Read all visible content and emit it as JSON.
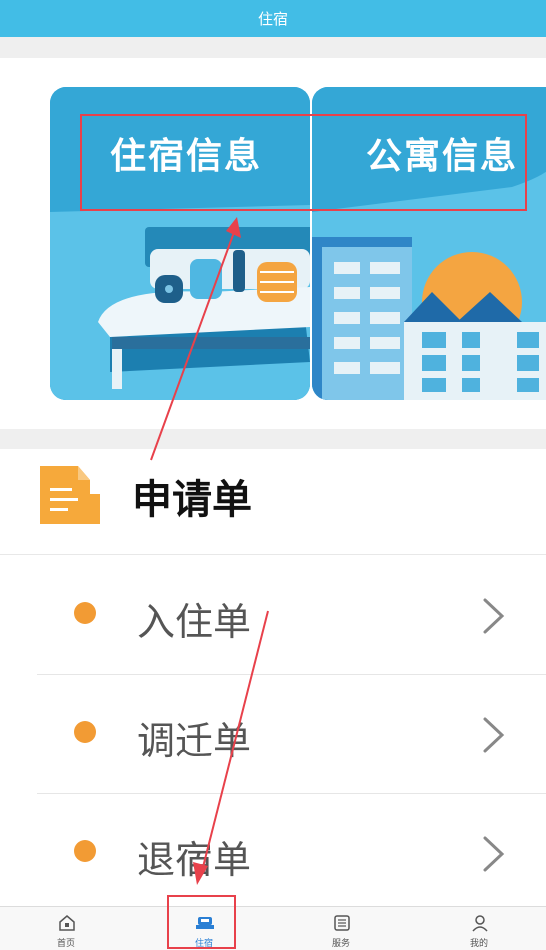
{
  "header": {
    "title": "住宿"
  },
  "banner": {
    "cards": [
      {
        "title": "住宿信息"
      },
      {
        "title": "公寓信息"
      }
    ]
  },
  "application": {
    "title": "申请单",
    "items": [
      {
        "label": "入住单"
      },
      {
        "label": "调迁单"
      },
      {
        "label": "退宿单"
      }
    ]
  },
  "tabbar": {
    "items": [
      {
        "label": "首页",
        "icon": "home-icon"
      },
      {
        "label": "住宿",
        "icon": "bed-icon",
        "active": true
      },
      {
        "label": "服务",
        "icon": "service-list-icon"
      },
      {
        "label": "我的",
        "icon": "user-icon"
      }
    ]
  },
  "colors": {
    "header": "#42bde6",
    "accent_dot": "#f29b34",
    "annotation": "#e8414b",
    "active_tab": "#2a7fd4"
  }
}
